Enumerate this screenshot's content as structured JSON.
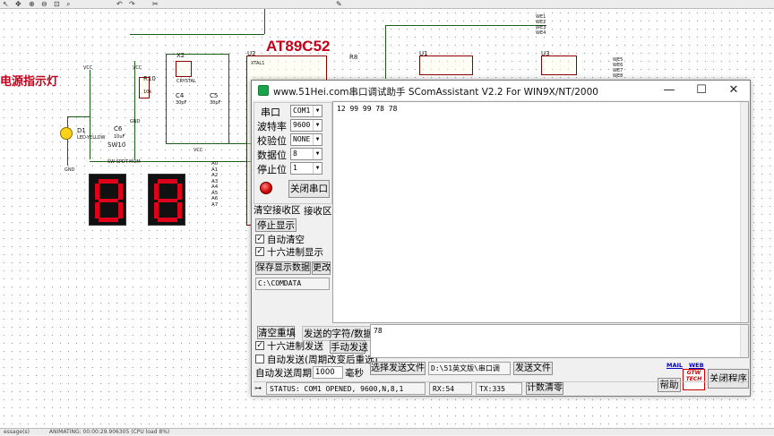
{
  "canvas": {
    "chip_title": "AT89C52",
    "power_label": "电源指示灯",
    "parts": {
      "u2": "U2",
      "u1": "U1",
      "u3": "U3",
      "x2": "X2",
      "r8": "R8",
      "r10": "R10",
      "c4": "C4",
      "c5": "C5",
      "c6": "C6",
      "d1": "D1",
      "sw": "SW10",
      "xtal": "XTAL1",
      "crystal": "CRYSTAL",
      "vcc": "VCC",
      "gnd": "GND",
      "r10_val": "10k",
      "c4_val": "30pF",
      "c5_val": "30pF",
      "c6_val": "10uF",
      "d1_val": "LED-YELLOW",
      "sw_val": "SW-SPDT-MOM"
    },
    "port_labels": [
      "A0",
      "A1",
      "A2",
      "A3",
      "A4",
      "A5",
      "A6",
      "A7"
    ],
    "we_labels": [
      "WE1",
      "WE2",
      "WE3",
      "WE4",
      "WE5",
      "WE6",
      "WE7",
      "WE8"
    ]
  },
  "statusbar": {
    "left": "essage(s)",
    "anim": "ANIMATING: 00:00:29.906305 (CPU load 8%)"
  },
  "window": {
    "site": "www.51Hei.com",
    "title": "串口调试助手  SComAssistant V2.2 For WIN9X/NT/2000",
    "minimize": "—",
    "maximize": "☐",
    "close": "✕",
    "labels": {
      "port": "串口",
      "baud": "波特率",
      "parity": "校验位",
      "databits": "数据位",
      "stopbits": "停止位"
    },
    "values": {
      "port": "COM1",
      "baud": "9600",
      "parity": "NONE",
      "databits": "8",
      "stopbits": "1"
    },
    "close_port": "关闭串口",
    "clear_recv": "清空接收区",
    "recv_area": "接收区",
    "stop_display": "停止显示",
    "auto_clear": "自动清空",
    "hex_display": "十六进制显示",
    "save_display": "保存显示数据",
    "change": "更改",
    "path": "C:\\COMDATA",
    "received": "12 99 99 78 78",
    "clear_redo": "清空重填",
    "send_char": "发送的字符/数据",
    "send_data": "78",
    "hex_send": "十六进制发送",
    "manual_send": "手动发送",
    "auto_send": "自动发送(周期改变后重选)",
    "auto_period": "自动发送周期:",
    "period_val": "1000",
    "ms": "毫秒",
    "choose_file": "选择发送文件",
    "file_path": "D:\\51英文版\\串口调",
    "send_file": "发送文件",
    "mail": "MAIL",
    "web": "WEB",
    "help": "帮助",
    "logo": "GTW TECH",
    "exit": "关闭程序",
    "status": "STATUS: COM1 OPENED, 9600,N,8,1",
    "rx": "RX:54",
    "tx": "TX:335",
    "clear_count": "计数清零"
  }
}
